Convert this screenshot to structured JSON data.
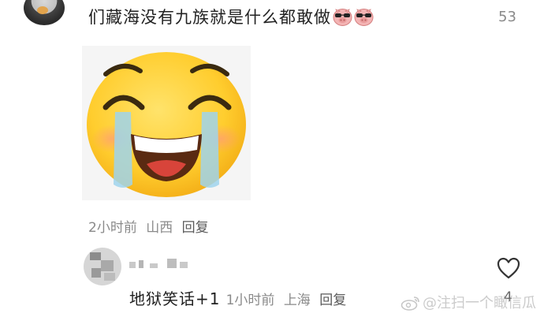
{
  "comment": {
    "text": "们藏海没有九族就是什么都敢做",
    "emojis": [
      "pig-sunglasses-emoji",
      "pig-sunglasses-emoji"
    ],
    "like_count": "53",
    "sticker": "laughing-crying-emoji-sticker",
    "meta": {
      "time": "2小时前",
      "location": "山西",
      "reply_label": "回复"
    }
  },
  "reply": {
    "username": "",
    "text": "地狱笑话+1",
    "meta": {
      "time": "1小时前",
      "location": "上海",
      "reply_label": "回复"
    },
    "like_count": "4"
  },
  "watermark": {
    "text": "@注扫一个瞰信瓜"
  },
  "colors": {
    "primary_text": "#222222",
    "secondary_text": "#8a8a8a",
    "background": "#ffffff"
  }
}
